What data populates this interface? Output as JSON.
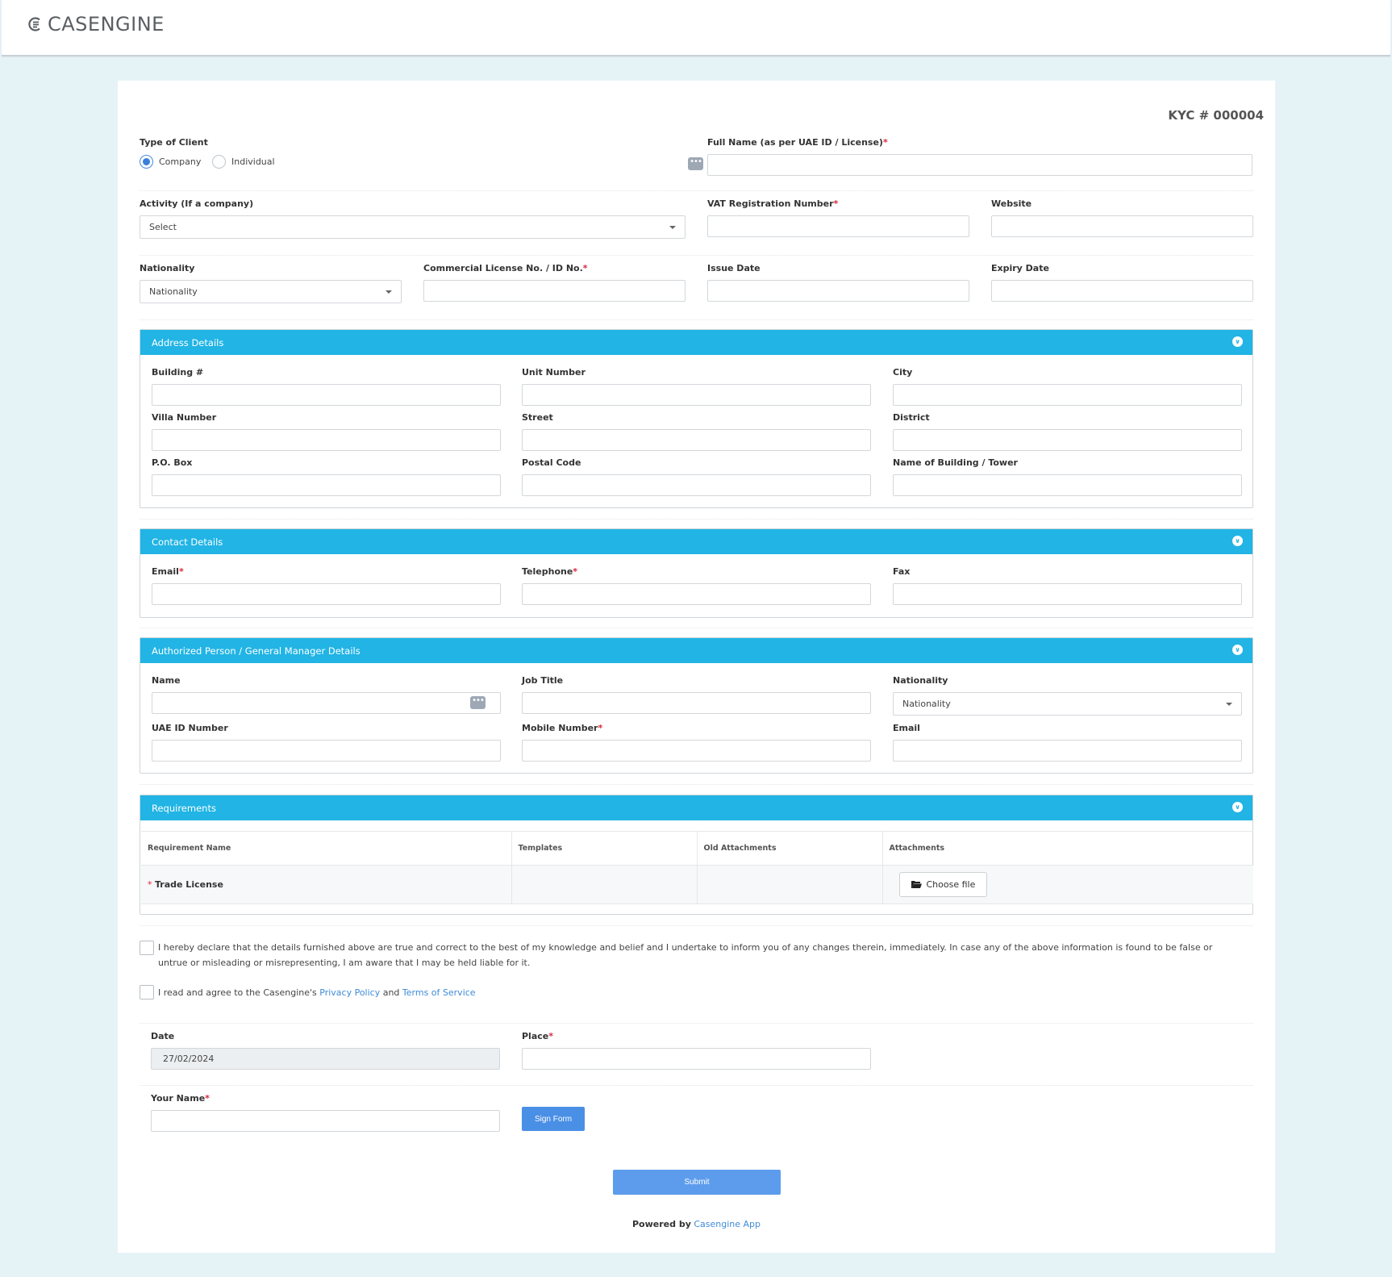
{
  "brand": {
    "name": "CASENGINE"
  },
  "form": {
    "kyc_number": "KYC # 000004",
    "type_of_client": {
      "label": "Type of Client",
      "options": [
        "Company",
        "Individual"
      ],
      "selected": "Company"
    },
    "full_name": {
      "label": "Full Name (as per UAE ID / License)",
      "required": "*",
      "value": ""
    },
    "activity": {
      "label": "Activity (If a company)",
      "value": "Select"
    },
    "vat": {
      "label": "VAT Registration Number",
      "required": "*",
      "value": ""
    },
    "website": {
      "label": "Website",
      "value": ""
    },
    "nationality": {
      "label": "Nationality",
      "value": "Nationality"
    },
    "license": {
      "label": "Commercial License No. / ID No.",
      "required": "*",
      "value": ""
    },
    "issue_date": {
      "label": "Issue Date",
      "value": ""
    },
    "expiry_date": {
      "label": "Expiry Date",
      "value": ""
    }
  },
  "address": {
    "title": "Address Details",
    "fields": [
      "Building #",
      "Unit Number",
      "City",
      "Villa Number",
      "Street",
      "District",
      "P.O. Box",
      "Postal Code",
      "Name of Building / Tower"
    ]
  },
  "contact": {
    "title": "Contact Details",
    "email": "Email",
    "telephone": "Telephone",
    "fax": "Fax",
    "required": "*"
  },
  "authorized": {
    "title": "Authorized Person / General Manager Details",
    "name": "Name",
    "job_title": "Job Title",
    "nationality": "Nationality",
    "nationality_value": "Nationality",
    "uae_id": "UAE ID Number",
    "mobile": "Mobile Number",
    "email": "Email",
    "required": "*"
  },
  "requirements": {
    "title": "Requirements",
    "columns": [
      "Requirement Name",
      "Templates",
      "Old Attachments",
      "Attachments"
    ],
    "rows": [
      {
        "marker": "*",
        "name": "Trade License",
        "action": "Choose file"
      }
    ]
  },
  "declaration": {
    "text": "I hereby declare that the details furnished above are true and correct to the best of my knowledge and belief and I undertake to inform you of any changes therein, immediately. In case any of the above information is found to be false or untrue or misleading or misrepresenting, I am aware that I may be held liable for it.",
    "agree_prefix": "I read and agree to the Casengine's",
    "privacy": "Privacy Policy",
    "and": "and",
    "terms": "Terms of Service"
  },
  "signing": {
    "date_label": "Date",
    "date_value": "27/02/2024",
    "place_label": "Place",
    "your_name_label": "Your Name",
    "required": "*",
    "sign_button": "Sign Form",
    "submit_button": "Submit"
  },
  "footer": {
    "powered_by": "Powered by",
    "app_link": "Casengine App"
  },
  "colors": {
    "panel_header": "#21b4e4",
    "button_blue": "#4a8fe6",
    "required": "#d9263a",
    "link": "#3f8bd8"
  }
}
